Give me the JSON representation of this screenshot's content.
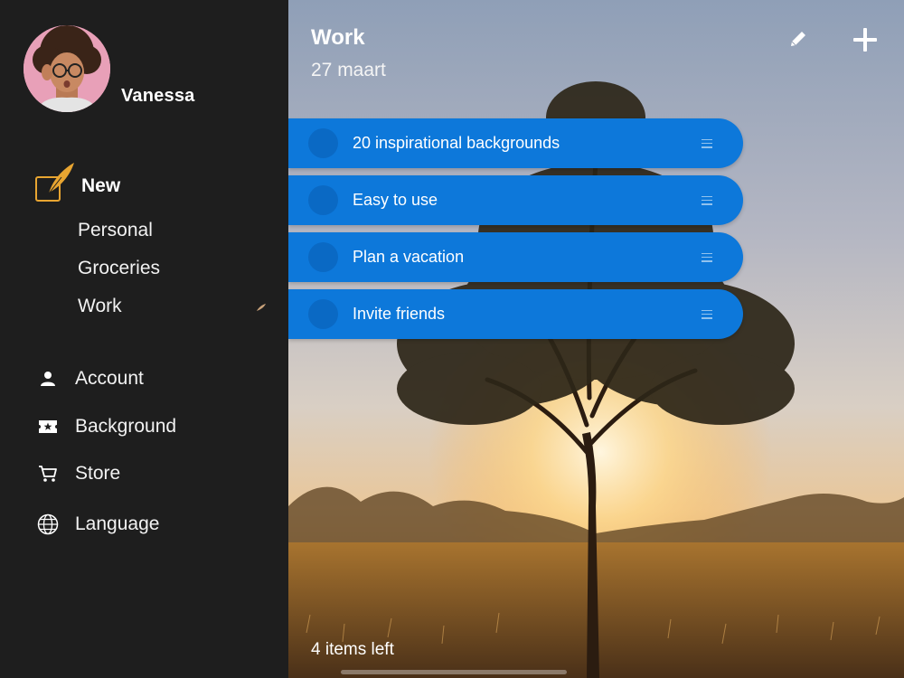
{
  "user": {
    "name": "Vanessa"
  },
  "sidebar": {
    "new_label": "New",
    "lists": [
      {
        "label": "Personal"
      },
      {
        "label": "Groceries"
      },
      {
        "label": "Work"
      }
    ],
    "menu": [
      {
        "label": "Account",
        "icon": "person-icon"
      },
      {
        "label": "Background",
        "icon": "background-ticket-icon"
      },
      {
        "label": "Store",
        "icon": "cart-icon"
      },
      {
        "label": "Language",
        "icon": "globe-icon"
      }
    ]
  },
  "main": {
    "title": "Work",
    "date": "27 maart",
    "tasks": [
      {
        "text": "20 inspirational backgrounds"
      },
      {
        "text": "Easy to use"
      },
      {
        "text": "Plan a vacation"
      },
      {
        "text": "Invite friends"
      }
    ],
    "footer": "4 items left"
  },
  "colors": {
    "sidebar_bg": "#1e1e1e",
    "task_bg": "#0d78da",
    "accent_gold": "#e8a531"
  }
}
